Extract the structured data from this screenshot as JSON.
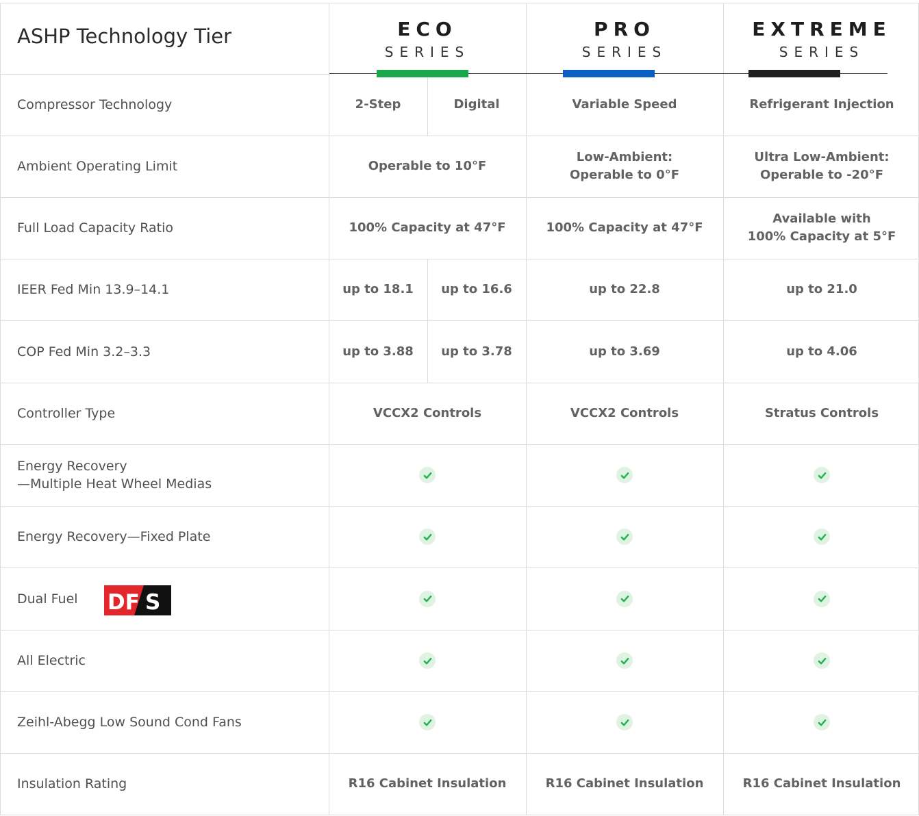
{
  "header": {
    "title": "ASHP Technology Tier",
    "tiers": [
      {
        "name": "ECO",
        "subtitle": "SERIES",
        "accent": "#1aa64a"
      },
      {
        "name": "PRO",
        "subtitle": "SERIES",
        "accent": "#0a5fc2"
      },
      {
        "name": "EXTREME",
        "subtitle": "SERIES",
        "accent": "#1f1f1f"
      }
    ]
  },
  "rows": {
    "compressor": {
      "label": "Compressor Technology",
      "eco_a": "2-Step",
      "eco_b": "Digital",
      "pro": "Variable Speed",
      "extreme": "Refrigerant Injection"
    },
    "ambient": {
      "label": "Ambient Operating Limit",
      "eco": "Operable to 10°F",
      "pro": "Low-Ambient:\nOperable to 0°F",
      "extreme": "Ultra Low-Ambient:\nOperable to -20°F"
    },
    "capacity": {
      "label": "Full Load Capacity Ratio",
      "eco": "100% Capacity at 47°F",
      "pro": "100% Capacity at 47°F",
      "extreme": "Available with\n100% Capacity at 5°F"
    },
    "ieer": {
      "label": "IEER Fed Min 13.9–14.1",
      "eco_a": "up to 18.1",
      "eco_b": "up to 16.6",
      "pro": "up to 22.8",
      "extreme": "up to 21.0"
    },
    "cop": {
      "label": "COP Fed Min 3.2–3.3",
      "eco_a": "up to 3.88",
      "eco_b": "up to 3.78",
      "pro": "up to 3.69",
      "extreme": "up to 4.06"
    },
    "controller": {
      "label": "Controller Type",
      "eco": "VCCX2 Controls",
      "pro": "VCCX2 Controls",
      "extreme": "Stratus Controls"
    },
    "er_wheel": {
      "label": "Energy Recovery\n—Multiple Heat Wheel Medias"
    },
    "er_plate": {
      "label": "Energy Recovery—Fixed Plate"
    },
    "dual_fuel": {
      "label": "Dual Fuel",
      "logo_text": "DFS"
    },
    "all_electric": {
      "label": "All Electric"
    },
    "fans": {
      "label": "Zeihl-Abegg Low Sound Cond Fans"
    },
    "insulation": {
      "label": "Insulation Rating",
      "eco": "R16 Cabinet Insulation",
      "pro": "R16 Cabinet Insulation",
      "extreme": "R16 Cabinet Insulation"
    }
  },
  "colors": {
    "check": "#22b24c",
    "check_bg": "#dff3e3",
    "logo_red": "#e3262b"
  }
}
